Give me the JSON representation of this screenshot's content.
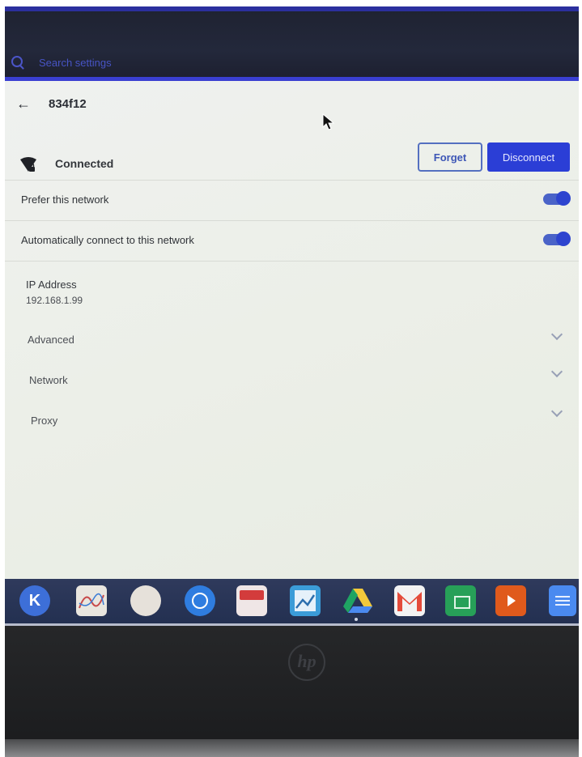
{
  "search": {
    "placeholder": "Search settings"
  },
  "network": {
    "name": "834f12",
    "status": "Connected",
    "forget_label": "Forget",
    "disconnect_label": "Disconnect"
  },
  "options": [
    {
      "label": "Prefer this network",
      "enabled": true
    },
    {
      "label": "Automatically connect to this network",
      "enabled": true
    }
  ],
  "ip": {
    "label": "IP Address",
    "value": "192.168.1.99"
  },
  "sections": [
    {
      "label": "Advanced"
    },
    {
      "label": "Network"
    },
    {
      "label": "Proxy"
    }
  ],
  "shelf_apps": [
    {
      "icon": "k-launcher-icon",
      "color": "#3d6fd8"
    },
    {
      "icon": "chart-app-icon",
      "color": "#e9e6df"
    },
    {
      "icon": "brain-app-icon",
      "color": "#e6e1da"
    },
    {
      "icon": "target-app-icon",
      "color": "#2f7de0"
    },
    {
      "icon": "pdf-app-icon",
      "color": "#efe6e6"
    },
    {
      "icon": "image-editor-icon",
      "color": "#3b9cd8"
    },
    {
      "icon": "drive-icon",
      "color": "#f3c93b"
    },
    {
      "icon": "gmail-icon",
      "color": "#e44b3b"
    },
    {
      "icon": "sheets-icon",
      "color": "#27a058"
    },
    {
      "icon": "slides-video-icon",
      "color": "#e05a1c"
    },
    {
      "icon": "docs-icon",
      "color": "#4a8af0"
    }
  ],
  "brand": {
    "logo_text": "hp"
  }
}
